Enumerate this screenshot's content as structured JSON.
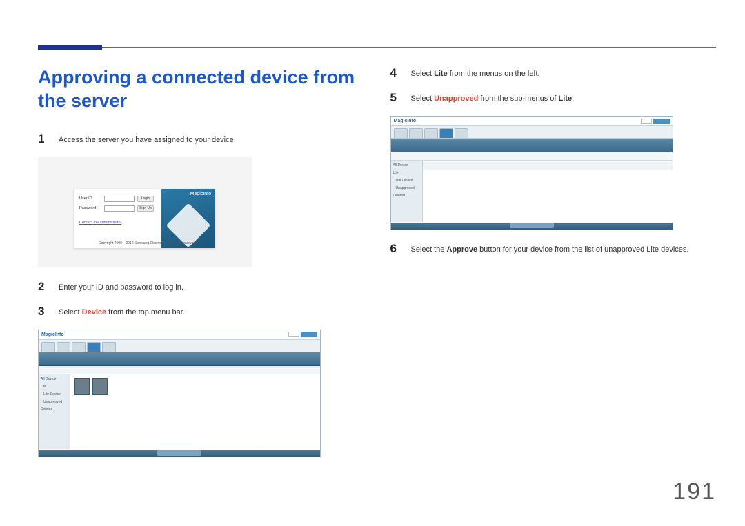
{
  "page_number": "191",
  "section_title": "Approving a connected device from the server",
  "steps": {
    "s1": {
      "num": "1",
      "text_a": "Access the server you have assigned to your device."
    },
    "s2": {
      "num": "2",
      "text_a": "Enter your ID and password to log in."
    },
    "s3": {
      "num": "3",
      "text_a": "Select ",
      "hl": "Device",
      "text_b": " from the top menu bar."
    },
    "s4": {
      "num": "4",
      "text_a": "Select ",
      "bold": "Lite",
      "text_b": " from the menus on the left."
    },
    "s5": {
      "num": "5",
      "text_a": "Select ",
      "hl": "Unapproved",
      "text_b": " from the sub-menus of ",
      "bold2": "Lite",
      "text_c": "."
    },
    "s6": {
      "num": "6",
      "text_a": "Select the ",
      "bold": "Approve",
      "text_b": " button for your device from the list of unapproved Lite devices."
    }
  },
  "login_shot": {
    "brand": "MagicInfo",
    "user_id_label": "User ID",
    "password_label": "Password",
    "login_btn": "Login",
    "signup_btn": "Sign Up",
    "contact_link": "Contact the administrator",
    "copyright": "Copyright 2009 – 2012 Samsung Electronics All rights reserved."
  },
  "app_shot": {
    "brand": "MagicInfo",
    "side_items": {
      "a": "All Device",
      "b": "Lite",
      "b1": "Lite Device",
      "b2": "Unapproved",
      "c": "Deleted"
    }
  }
}
